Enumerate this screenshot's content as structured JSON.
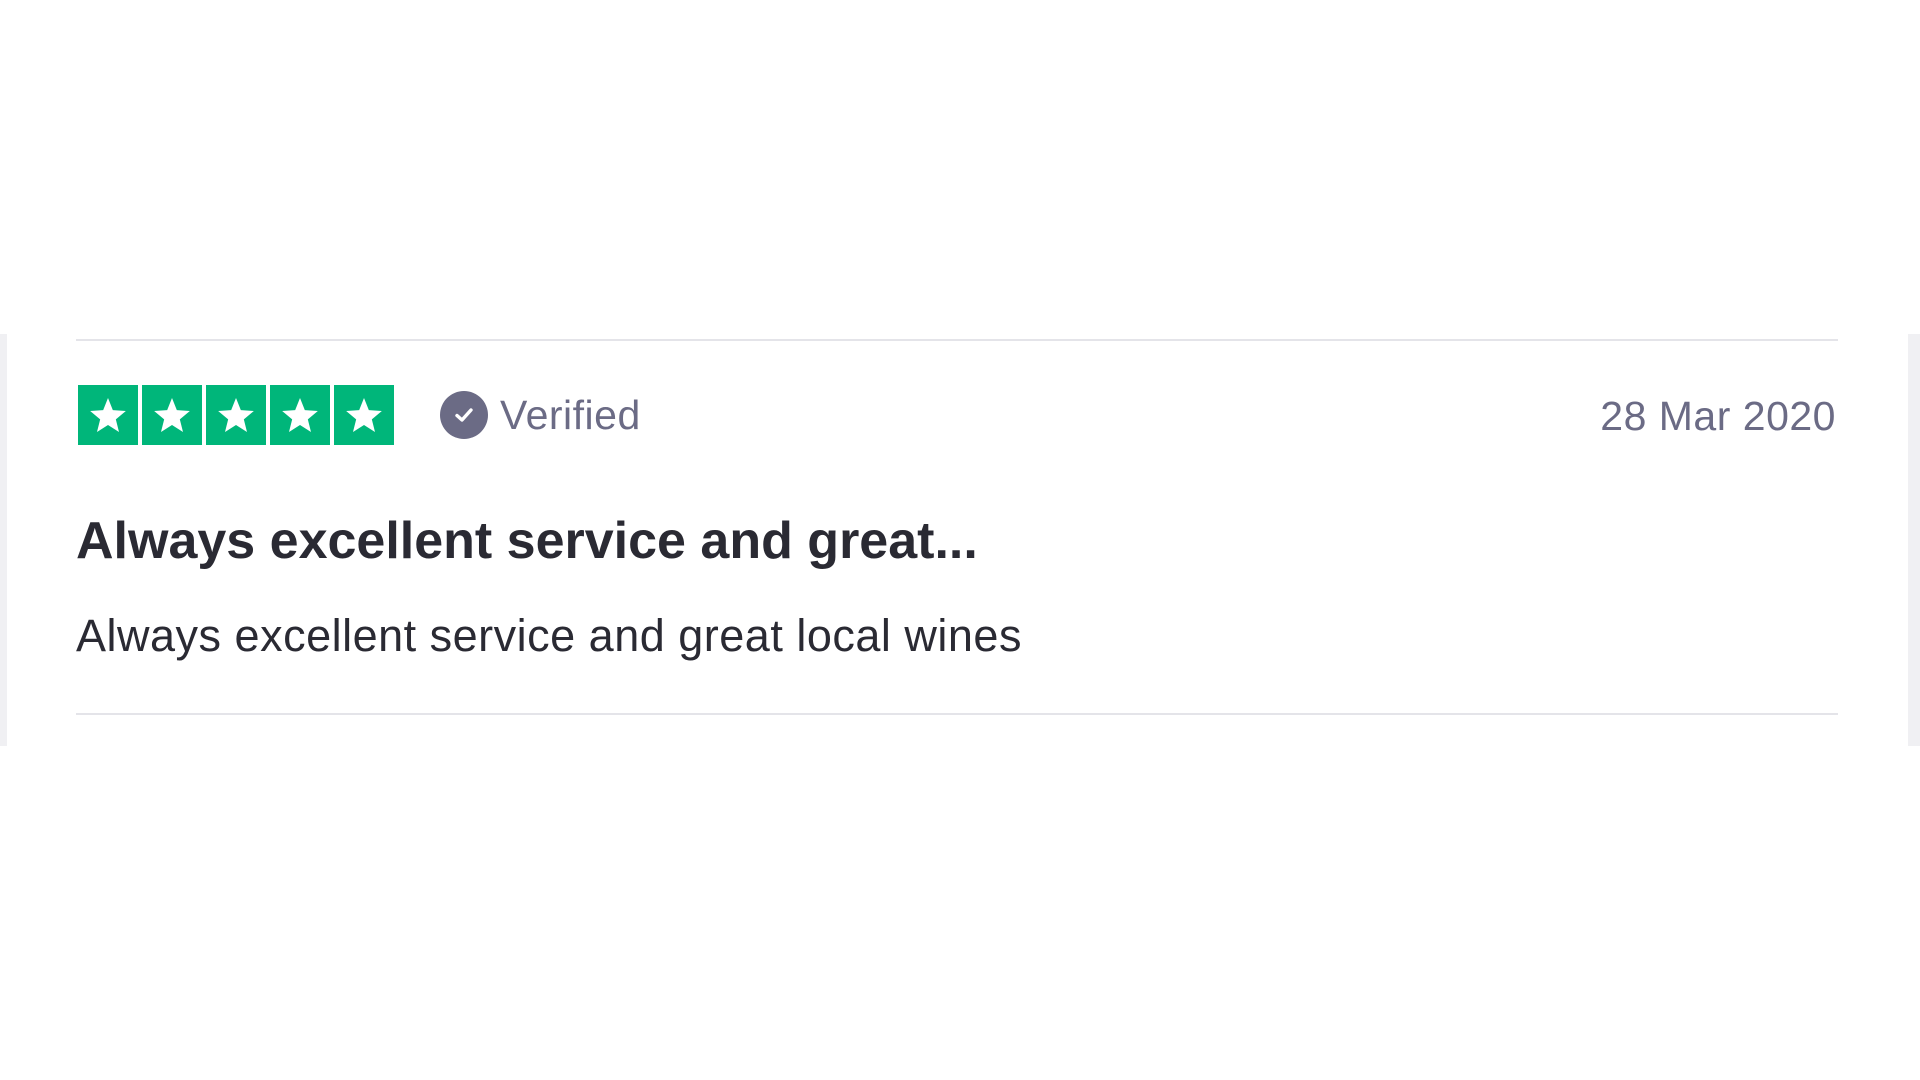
{
  "review": {
    "rating": 5,
    "rating_max": 5,
    "star_color": "#00b67a",
    "star_icon": "star-icon",
    "verified_icon": "check-circle-icon",
    "verified_label": "Verified",
    "date": "28 Mar 2020",
    "title": "Always excellent service and great...",
    "body": "Always excellent service and great local wines"
  }
}
